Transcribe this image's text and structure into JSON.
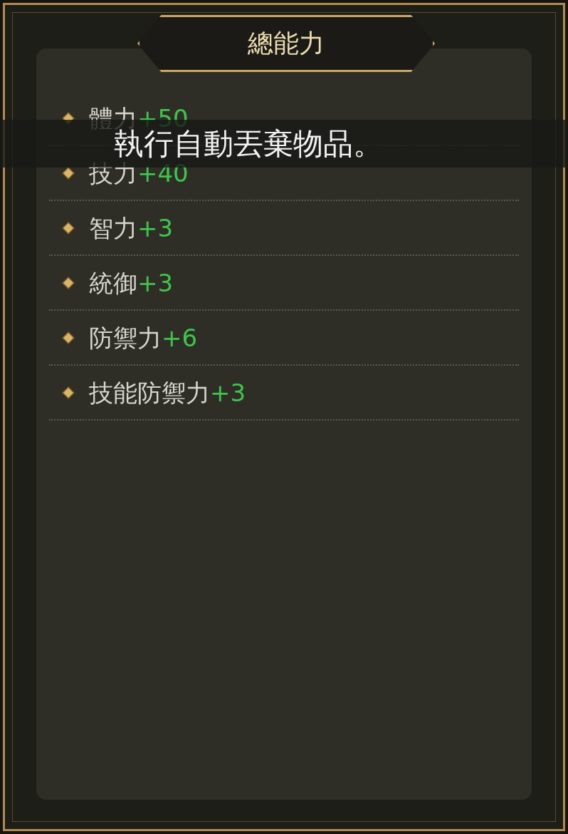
{
  "title": "總能力",
  "stats": [
    {
      "label": "體力",
      "value": "+50"
    },
    {
      "label": "技力",
      "value": "+40"
    },
    {
      "label": "智力",
      "value": "+3"
    },
    {
      "label": "統御",
      "value": "+3"
    },
    {
      "label": "防禦力",
      "value": "+6"
    },
    {
      "label": "技能防禦力",
      "value": "+3"
    }
  ],
  "toast": "執行自動丟棄物品。"
}
